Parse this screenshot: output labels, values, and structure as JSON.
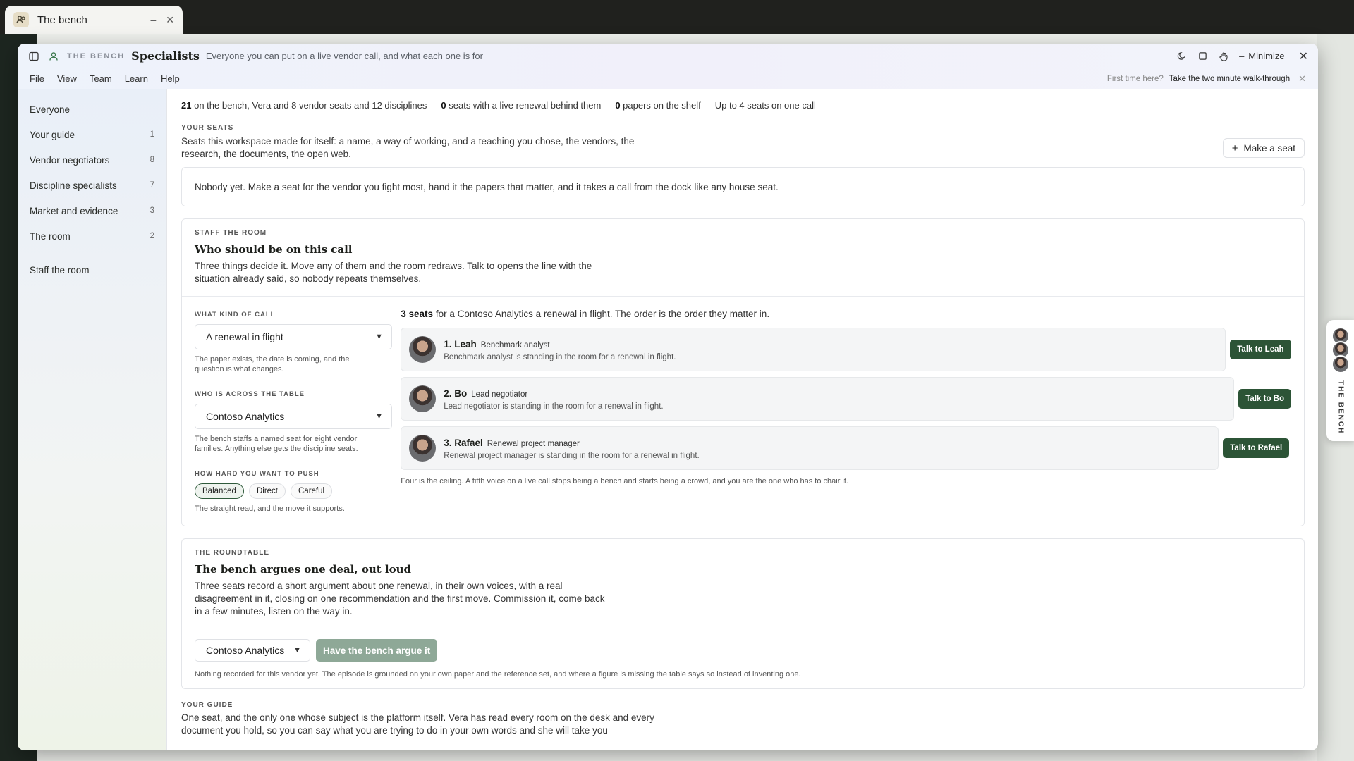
{
  "os_tab": {
    "title": "The bench"
  },
  "window": {
    "brand": "THE BENCH",
    "title": "Specialists",
    "subtitle": "Everyone you can put on a live vendor call, and what each one is for",
    "minimize_label": "Minimize"
  },
  "menu": {
    "items": [
      "File",
      "View",
      "Team",
      "Learn",
      "Help"
    ],
    "hint": "First time here?",
    "walkthrough": "Take the two minute walk-through"
  },
  "sidebar": {
    "items": [
      {
        "label": "Everyone",
        "count": ""
      },
      {
        "label": "Your guide",
        "count": "1"
      },
      {
        "label": "Vendor negotiators",
        "count": "8"
      },
      {
        "label": "Discipline specialists",
        "count": "7"
      },
      {
        "label": "Market and evidence",
        "count": "3"
      },
      {
        "label": "The room",
        "count": "2"
      },
      {
        "label": "Staff the room",
        "count": ""
      }
    ]
  },
  "stats": {
    "s1_num": "21",
    "s1_text": "on the bench, Vera and 8 vendor seats and 12 disciplines",
    "s2_num": "0",
    "s2_text": "seats with a live renewal behind them",
    "s3_num": "0",
    "s3_text": "papers on the shelf",
    "s4_text": "Up to 4 seats on one call"
  },
  "your_seats": {
    "eyebrow": "YOUR SEATS",
    "desc": "Seats this workspace made for itself: a name, a way of working, and a teaching you chose, the vendors, the research, the documents, the open web.",
    "make_button": "Make a seat",
    "empty": "Nobody yet. Make a seat for the vendor you fight most, hand it the papers that matter, and it takes a call from the dock like any house seat."
  },
  "staff": {
    "eyebrow": "STAFF THE ROOM",
    "title": "Who should be on this call",
    "desc": "Three things decide it. Move any of them and the room redraws. Talk to opens the line with the situation already said, so nobody repeats themselves.",
    "call_label": "WHAT KIND OF CALL",
    "call_value": "A renewal in flight",
    "call_note": "The paper exists, the date is coming, and the question is what changes.",
    "across_label": "WHO IS ACROSS THE TABLE",
    "across_value": "Contoso Analytics",
    "across_note": "The bench staffs a named seat for eight vendor families. Anything else gets the discipline seats.",
    "push_label": "HOW HARD YOU WANT TO PUSH",
    "push_options": [
      "Balanced",
      "Direct",
      "Careful"
    ],
    "push_note": "The straight read, and the move it supports.",
    "lead_bold": "3 seats",
    "lead_text": "for a Contoso Analytics a renewal in flight. The order is the order they matter in.",
    "seats": [
      {
        "name": "1. Leah",
        "role": "Benchmark analyst",
        "line": "Benchmark analyst is standing in the room for a renewal in flight.",
        "talk": "Talk to Leah"
      },
      {
        "name": "2. Bo",
        "role": "Lead negotiator",
        "line": "Lead negotiator is standing in the room for a renewal in flight.",
        "talk": "Talk to Bo"
      },
      {
        "name": "3. Rafael",
        "role": "Renewal project manager",
        "line": "Renewal project manager is standing in the room for a renewal in flight.",
        "talk": "Talk to Rafael"
      }
    ],
    "ceiling": "Four is the ceiling. A fifth voice on a live call stops being a bench and starts being a crowd, and you are the one who has to chair it."
  },
  "roundtable": {
    "eyebrow": "THE ROUNDTABLE",
    "title": "The bench argues one deal, out loud",
    "desc": "Three seats record a short argument about one renewal, in their own voices, with a real disagreement in it, closing on one recommendation and the first move. Commission it, come back in a few minutes, listen on the way in.",
    "vendor_value": "Contoso Analytics",
    "argue_button": "Have the bench argue it",
    "note": "Nothing recorded for this vendor yet. The episode is grounded on your own paper and the reference set, and where a figure is missing the table says so instead of inventing one."
  },
  "guide": {
    "eyebrow": "YOUR GUIDE",
    "desc": "One seat, and the only one whose subject is the platform itself. Vera has read every room on the desk and every document you hold, so you can say what you are trying to do in your own words and she will take you"
  },
  "dock": {
    "label": "THE BENCH"
  }
}
